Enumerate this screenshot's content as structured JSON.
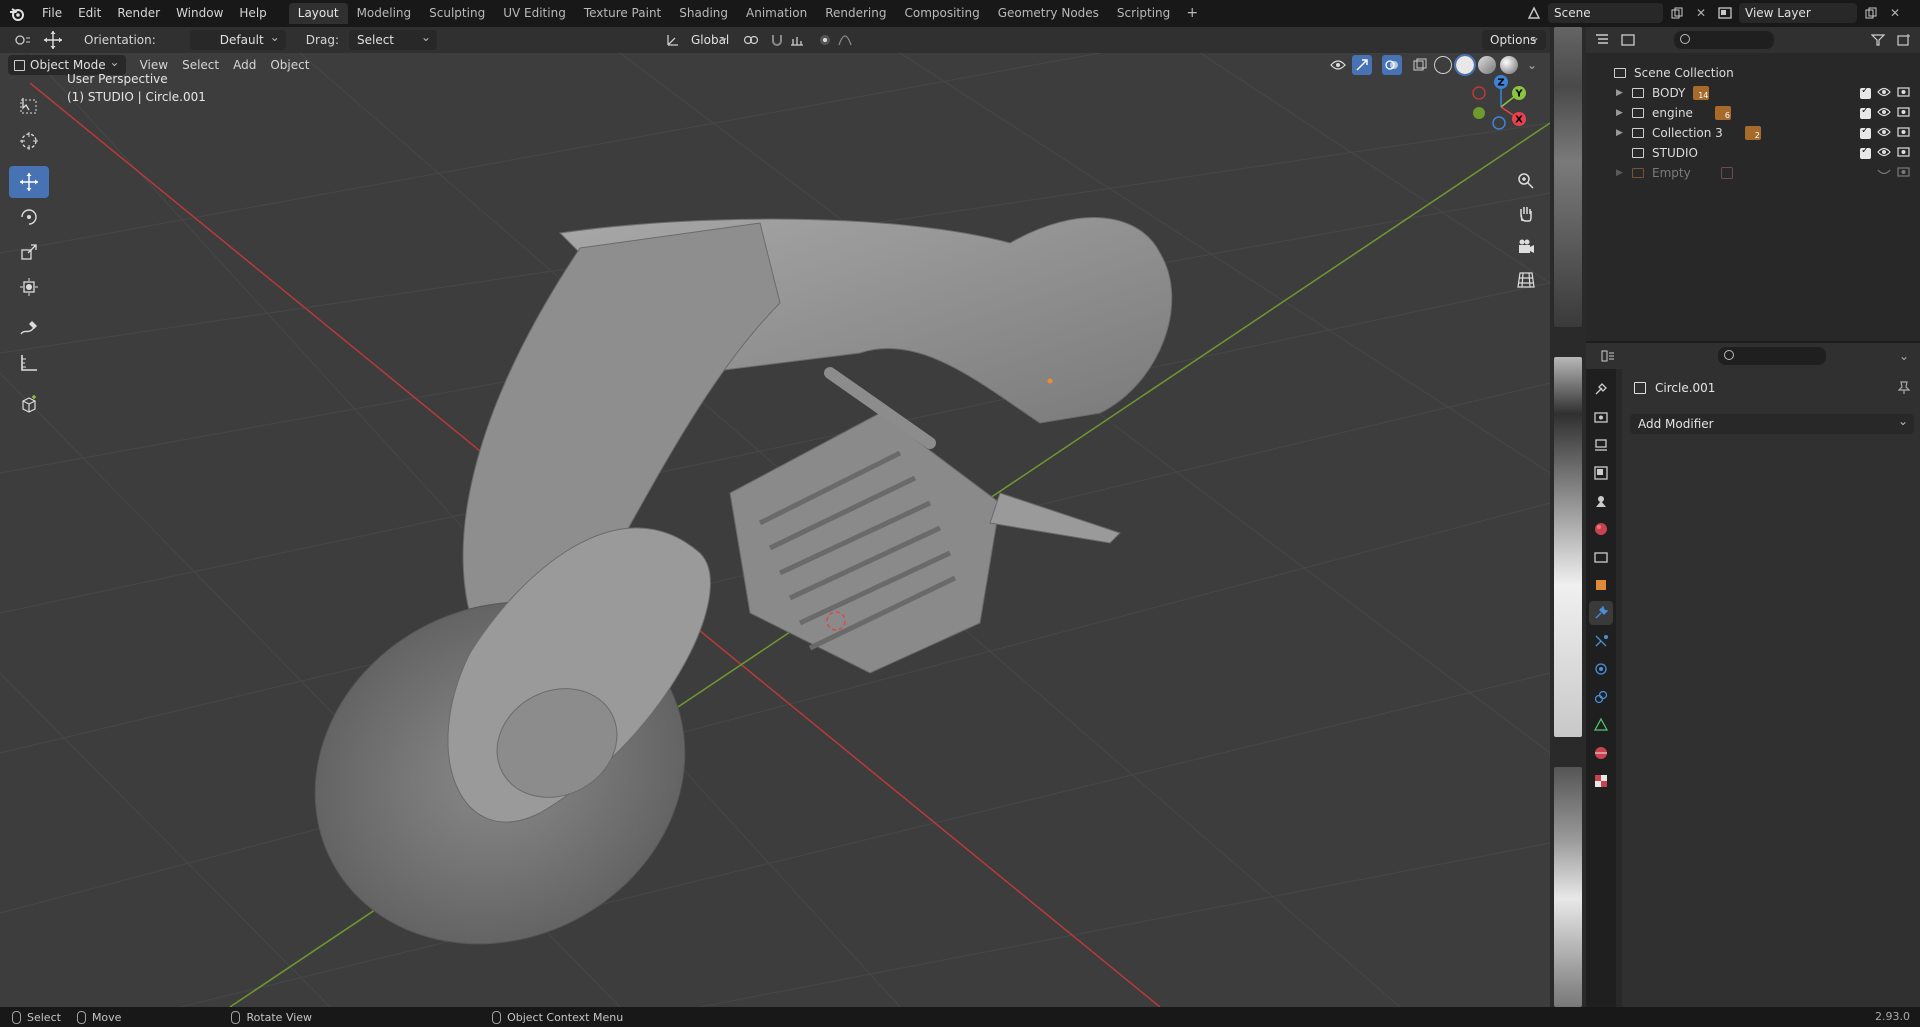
{
  "topbar": {
    "menus": [
      "File",
      "Edit",
      "Render",
      "Window",
      "Help"
    ],
    "workspaces": [
      "Layout",
      "Modeling",
      "Sculpting",
      "UV Editing",
      "Texture Paint",
      "Shading",
      "Animation",
      "Rendering",
      "Compositing",
      "Geometry Nodes",
      "Scripting"
    ],
    "active_workspace": "Layout",
    "scene": "Scene",
    "view_layer": "View Layer"
  },
  "viewport_header": {
    "orientation_label": "Orientation:",
    "orientation_value": "Default",
    "drag_label": "Drag:",
    "drag_value": "Select Box",
    "transform_orientation": "Global",
    "options": "Options"
  },
  "viewport": {
    "mode": "Object Mode",
    "menus": [
      "View",
      "Select",
      "Add",
      "Object"
    ],
    "perspective": "User Perspective",
    "active_info": "(1) STUDIO | Circle.001",
    "gizmo_axes": [
      "Z",
      "Y",
      "X"
    ],
    "axis_colors": {
      "x": "#e8424f",
      "y": "#8bc540",
      "z": "#3b85d8",
      "grid_x_line": "#b83a3a",
      "grid_y_line": "#6f9a2e"
    },
    "tools": [
      "select-box-icon",
      "cursor-icon",
      "move-icon",
      "rotate-icon",
      "scale-icon",
      "transform-icon",
      "annotate-icon",
      "measure-icon",
      "add-cube-icon"
    ],
    "active_tool": "move-icon",
    "accent_color": "#4772b3"
  },
  "outliner": {
    "root": "Scene Collection",
    "items": [
      {
        "name": "BODY",
        "badge": "14",
        "visible": true
      },
      {
        "name": "engine",
        "badge": "6",
        "visible": true
      },
      {
        "name": "Collection 3",
        "badge": "2",
        "visible": true
      },
      {
        "name": "STUDIO",
        "badge": "",
        "visible": true
      },
      {
        "name": "Empty",
        "badge": "",
        "visible": false
      }
    ]
  },
  "properties": {
    "object_name": "Circle.001",
    "add_modifier": "Add Modifier",
    "tabs": [
      "tool-icon",
      "render-icon",
      "output-icon",
      "view-layer-icon",
      "scene-icon",
      "world-icon",
      "collection-icon",
      "object-icon",
      "modifier-icon",
      "particles-icon",
      "physics-icon",
      "constraints-icon",
      "data-icon",
      "material-icon",
      "texture-icon"
    ],
    "active_tab": "modifier-icon"
  },
  "statusbar": {
    "select": "Select",
    "move": "Move",
    "rotate_view": "Rotate View",
    "context_menu": "Object Context Menu",
    "version": "2.93.0"
  }
}
